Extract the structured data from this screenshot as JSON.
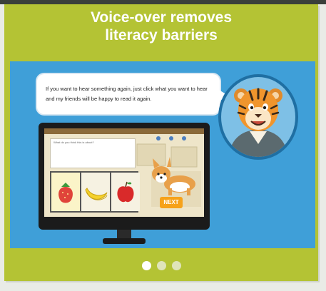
{
  "slide": {
    "title_line1": "Voice-over removes",
    "title_line2": "literacy barriers",
    "speech": "If you want to hear something again, just click what you want to hear and my friends will be happy to read it again.",
    "screen": {
      "question_prompt": "What do you think this is about?",
      "next_label": "NEXT"
    }
  },
  "carousel": {
    "slides_total": 3,
    "active_index": 0
  },
  "colors": {
    "card_bg": "#b4c334",
    "scene_bg": "#3f9fd8",
    "accent_orange": "#f6a21a"
  }
}
